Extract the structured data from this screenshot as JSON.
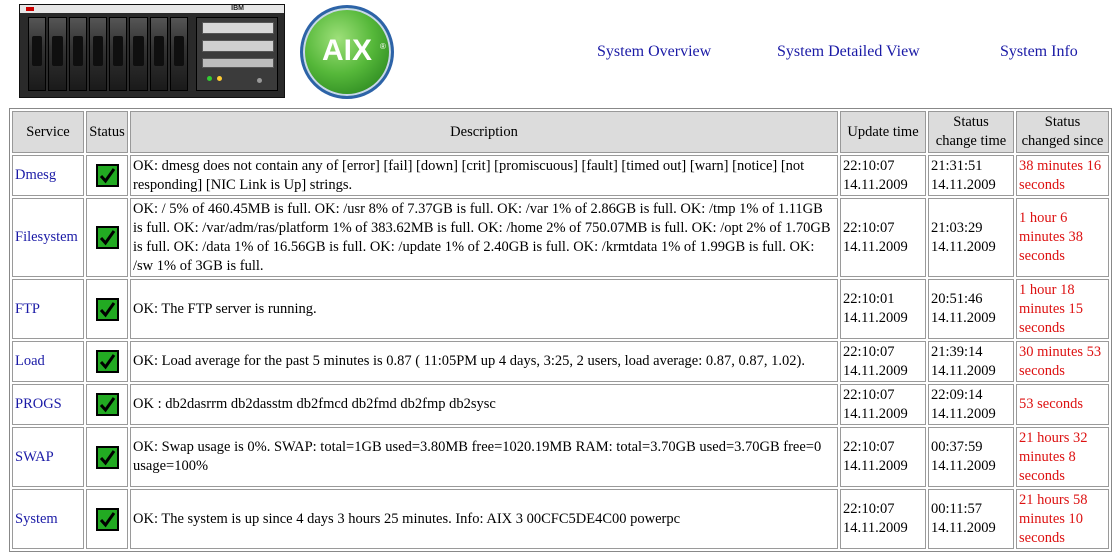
{
  "header": {
    "server_brand": "IBM",
    "logo_text": "AIX",
    "logo_mark": "®",
    "nav": [
      {
        "label": "System Overview"
      },
      {
        "label": "System Detailed View"
      },
      {
        "label": "System Info"
      }
    ]
  },
  "table": {
    "columns": [
      "Service",
      "Status",
      "Description",
      "Update time",
      "Status change time",
      "Status changed since"
    ],
    "rows": [
      {
        "service": "Dmesg",
        "status_icon": "check-icon",
        "description": "OK: dmesg does not contain any of [error] [fail] [down] [crit] [promiscuous] [fault] [timed out] [warn] [notice] [not responding] [NIC Link is Up] strings.",
        "update_time": "22:10:07",
        "update_date": "14.11.2009",
        "change_time": "21:31:51",
        "change_date": "14.11.2009",
        "changed_since": "38 minutes 16 seconds"
      },
      {
        "service": "Filesystem",
        "status_icon": "check-icon",
        "description": "OK: / 5% of 460.45MB is full. OK: /usr 8% of 7.37GB is full. OK: /var 1% of 2.86GB is full. OK: /tmp 1% of 1.11GB is full. OK: /var/adm/ras/platform 1% of 383.62MB is full. OK: /home 2% of 750.07MB is full. OK: /opt 2% of 1.70GB is full. OK: /data 1% of 16.56GB is full. OK: /update 1% of 2.40GB is full. OK: /krmtdata 1% of 1.99GB is full. OK: /sw 1% of 3GB is full.",
        "update_time": "22:10:07",
        "update_date": "14.11.2009",
        "change_time": "21:03:29",
        "change_date": "14.11.2009",
        "changed_since": "1 hour 6 minutes 38 seconds"
      },
      {
        "service": "FTP",
        "status_icon": "check-icon",
        "description": "OK: The FTP server is running.",
        "update_time": "22:10:01",
        "update_date": "14.11.2009",
        "change_time": "20:51:46",
        "change_date": "14.11.2009",
        "changed_since": "1 hour 18 minutes 15 seconds"
      },
      {
        "service": "Load",
        "status_icon": "check-icon",
        "description": "OK: Load average for the past 5 minutes is 0.87 ( 11:05PM up 4 days, 3:25, 2 users, load average: 0.87, 0.87, 1.02).",
        "update_time": "22:10:07",
        "update_date": "14.11.2009",
        "change_time": "21:39:14",
        "change_date": "14.11.2009",
        "changed_since": "30 minutes 53 seconds"
      },
      {
        "service": "PROGS",
        "status_icon": "check-icon",
        "description": "OK : db2dasrrm db2dasstm db2fmcd db2fmd db2fmp db2sysc",
        "update_time": "22:10:07",
        "update_date": "14.11.2009",
        "change_time": "22:09:14",
        "change_date": "14.11.2009",
        "changed_since": "53 seconds"
      },
      {
        "service": "SWAP",
        "status_icon": "check-icon",
        "description": "OK: Swap usage is 0%. SWAP: total=1GB used=3.80MB free=1020.19MB RAM: total=3.70GB used=3.70GB free=0 usage=100%",
        "update_time": "22:10:07",
        "update_date": "14.11.2009",
        "change_time": "00:37:59",
        "change_date": "14.11.2009",
        "changed_since": "21 hours 32 minutes 8 seconds"
      },
      {
        "service": "System",
        "status_icon": "check-icon",
        "description": "OK: The system is up since 4 days 3 hours 25 minutes. Info: AIX 3 00CFC5DE4C00 powerpc",
        "update_time": "22:10:07",
        "update_date": "14.11.2009",
        "change_time": "00:11:57",
        "change_date": "14.11.2009",
        "changed_since": "21 hours 58 minutes 10 seconds"
      }
    ]
  },
  "colors": {
    "link": "#1a1aa6",
    "since_text": "#dd1111",
    "header_bg": "#dcdcdc",
    "check_green": "#22aa22"
  }
}
